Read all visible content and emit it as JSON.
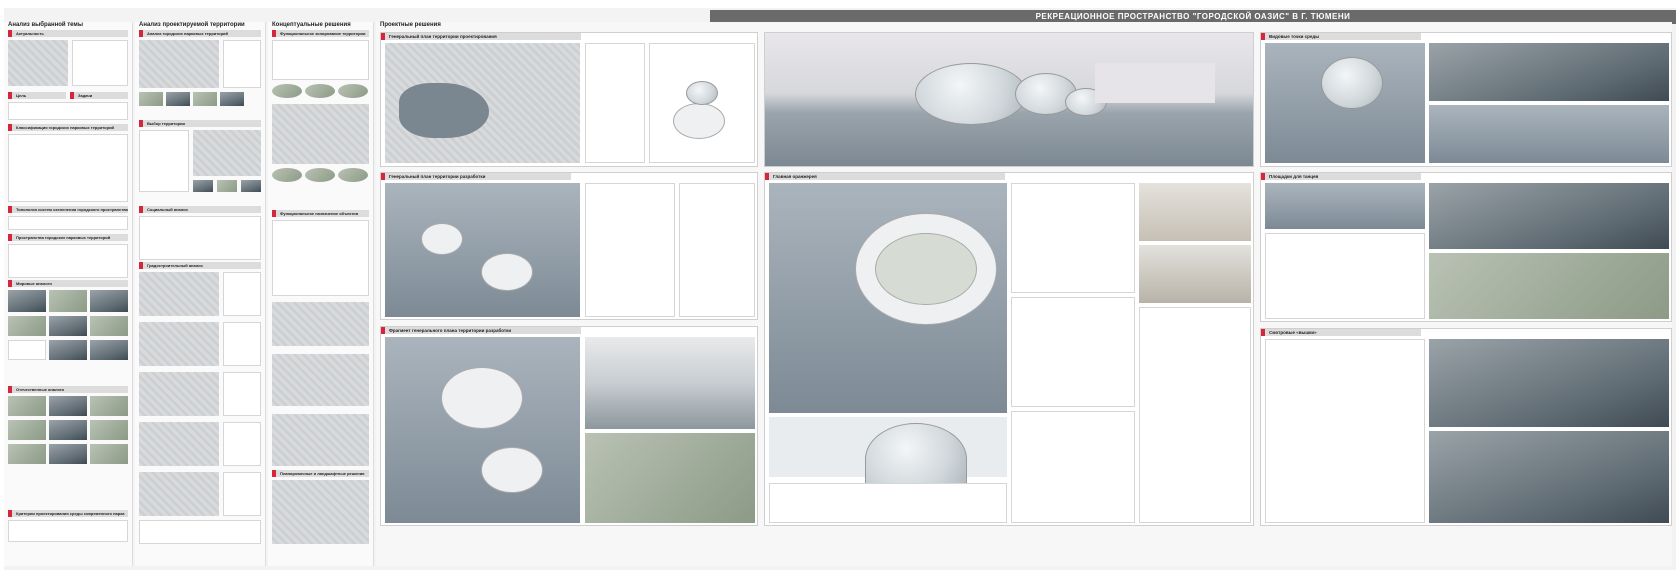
{
  "poster": {
    "title": "РЕКРЕАЦИОННОЕ ПРОСТРАНСТВО \"ГОРОДСКОЙ ОАЗИС\" В Г. ТЮМЕНИ"
  },
  "columns": {
    "c1": "Анализ выбранной темы",
    "c2": "Анализ проектируемой территории",
    "c3": "Концептуальные решения",
    "c4": "Проектные решения"
  },
  "sections": {
    "aktualnost": "Актуальность",
    "tsel": "Цель",
    "zadachi": "Задачи",
    "klassifikatsiya": "Классификация городских парковых территорий",
    "tipologiya": "Типология систем озеленения городского пространства",
    "prostranstva": "Пространства городских парковых территорий",
    "mirovoy": "Мировые аналоги",
    "otechestvenny": "Отечественные аналоги",
    "kriterii": "Критерии проектирования среды современного парка",
    "analiz_parkov": "Анализ городских парковых территорий",
    "vybor": "Выбор территории",
    "sotsialny": "Социальный анализ",
    "gradostroitelny": "Градостроительный анализ",
    "funktsionalnoe": "Функциональное зонирование территории проектирования",
    "naznachenie": "Функциональное назначение объектов проектирования",
    "landshaftnye": "Планировочные и ландшафтные решения",
    "sushchestvuyushchaya": "Существующая застройка прилегающей территории",
    "genplan": "Генеральный план территории проектирования",
    "genplan_razrabotka": "Генеральный план территории разработки",
    "fragment": "Фрагмент генерального плана территории разработки",
    "glavnaya": "Главная оранжерея",
    "vidovye": "Видовые точки среды",
    "ploshchadki": "Площадки для танцев",
    "smotrovye": "Смотровые «вышки»"
  }
}
